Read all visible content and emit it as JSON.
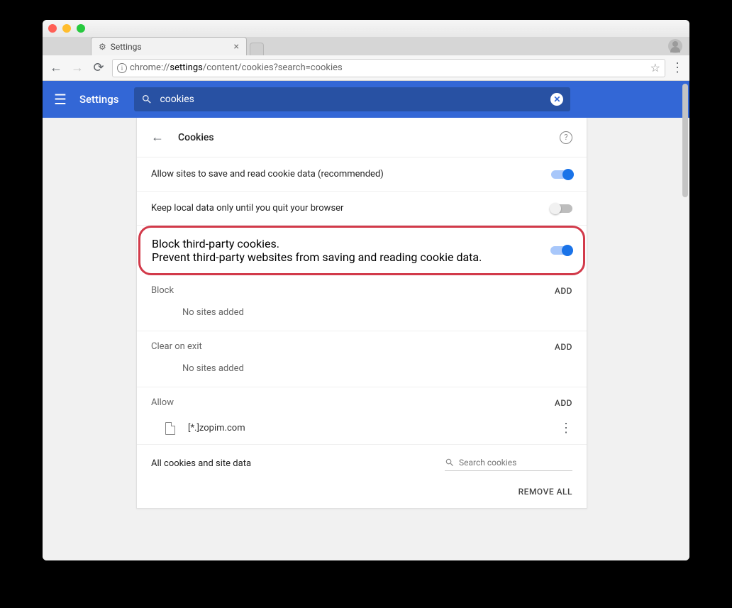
{
  "window": {
    "traffic_colors": {
      "close": "#ff5f56",
      "min": "#ffbd2e",
      "max": "#27c93f"
    }
  },
  "tab": {
    "title": "Settings"
  },
  "omnibox": {
    "prefix": "chrome://",
    "bold": "settings",
    "suffix": "/content/cookies?search=cookies"
  },
  "bluebar": {
    "title": "Settings",
    "search_value": "cookies"
  },
  "panel": {
    "title": "Cookies",
    "rows": {
      "allow": {
        "label": "Allow sites to save and read cookie data (recommended)",
        "on": true
      },
      "keep_local": {
        "label": "Keep local data only until you quit your browser",
        "on": false
      },
      "block_tp": {
        "label": "Block third-party cookies.",
        "sub": "Prevent third-party websites from saving and reading cookie data.",
        "on": true
      }
    },
    "sections": {
      "block": {
        "title": "Block",
        "add": "ADD",
        "empty": "No sites added"
      },
      "clear": {
        "title": "Clear on exit",
        "add": "ADD",
        "empty": "No sites added"
      },
      "allow": {
        "title": "Allow",
        "add": "ADD",
        "sites": [
          {
            "domain": "[*.]zopim.com"
          }
        ]
      }
    },
    "bottom": {
      "label": "All cookies and site data",
      "search_placeholder": "Search cookies",
      "remove_all": "REMOVE ALL"
    }
  }
}
